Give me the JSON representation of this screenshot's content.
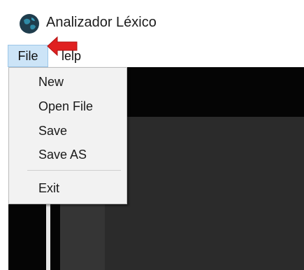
{
  "window": {
    "title": "Analizador Léxico",
    "icon": "globe-app-icon"
  },
  "menubar": {
    "file_label": "File",
    "help_label": "Help",
    "help_visible_text": "lelp"
  },
  "file_menu": {
    "items": [
      "New",
      "Open File",
      "Save",
      "Save AS"
    ],
    "exit_label": "Exit"
  },
  "annotation": {
    "icon": "red-arrow-icon",
    "color": "#e02020"
  },
  "colors": {
    "menu_highlight": "#cce4f7",
    "editor_background": "#050505",
    "panel_background": "#2b2b2b"
  }
}
